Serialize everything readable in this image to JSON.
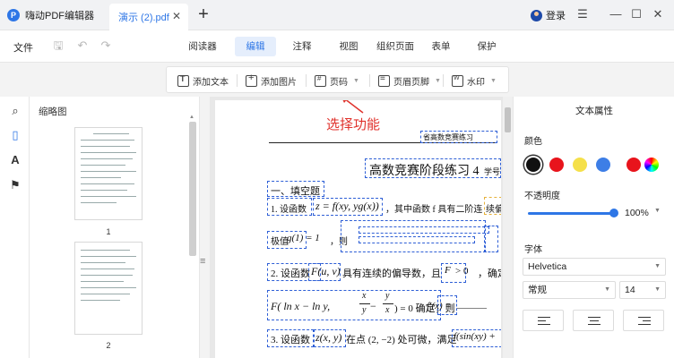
{
  "titlebar": {
    "app_name": "嗨动PDF编辑器",
    "doc_tab": "演示 (2).pdf",
    "login": "登录"
  },
  "ribbon": {
    "file_menu": "文件",
    "tabs": [
      {
        "label": "阅读器",
        "active": false
      },
      {
        "label": "编辑",
        "active": true
      },
      {
        "label": "注释",
        "active": false
      },
      {
        "label": "视图",
        "active": false
      },
      {
        "label": "组织页面",
        "active": false
      },
      {
        "label": "表单",
        "active": false
      },
      {
        "label": "保护",
        "active": false
      }
    ]
  },
  "toolbar": {
    "add_text": "添加文本",
    "add_image": "添加图片",
    "page_number": "页码",
    "header_footer": "页眉页脚",
    "watermark": "水印"
  },
  "thumbnails": {
    "title": "缩略图",
    "pages": [
      "1",
      "2"
    ]
  },
  "document": {
    "annotation": "选择功能",
    "header_label": "省高数竞赛练习",
    "title": "高数竞赛阶段练习 4",
    "title_suffix": "学号",
    "section": "一、填空题",
    "line1_a": "1. 设函数",
    "line1_b": "z = f(xy, yg(x))",
    "line1_c": "，其中函数 f 具有二阶连",
    "line1_d": "续偏导",
    "line2_a": "极值",
    "line2_b": "g(1) = 1",
    "line2_c": "，则",
    "line3_a": "2. 设函数",
    "line3_b": "F(u, v)",
    "line3_c": "具有连续的偏导数，且",
    "line3_d": "F",
    "line3_e": "> 0",
    "line3_f": "，确定",
    "line4_a": "F( ln x − ln y, ",
    "line4_frac_n": "x",
    "line4_frac_d": "y",
    "line4_b": " − ",
    "line4_frac2_n": "y",
    "line4_frac2_d": "x",
    "line4_c": " ) = 0 确定，则",
    "line4_d": "f′(x) =",
    "line4_e": "______",
    "line5_a": "3. 设函数",
    "line5_b": "z(x, y)",
    "line5_c": "在点 (2, −2) 处可微，满足",
    "line5_d": "f(sin(xy) +"
  },
  "properties": {
    "title": "文本属性",
    "color_label": "颜色",
    "colors": [
      "#111111",
      "#e8141c",
      "#f5e04a",
      "#3d7ee6",
      "#e8141c"
    ],
    "selected_color_index": 0,
    "opacity_label": "不透明度",
    "opacity": "100%",
    "opacity_fraction": 1.0,
    "font_label": "字体",
    "font_family": "Helvetica",
    "font_style": "常规",
    "font_size": "14"
  }
}
